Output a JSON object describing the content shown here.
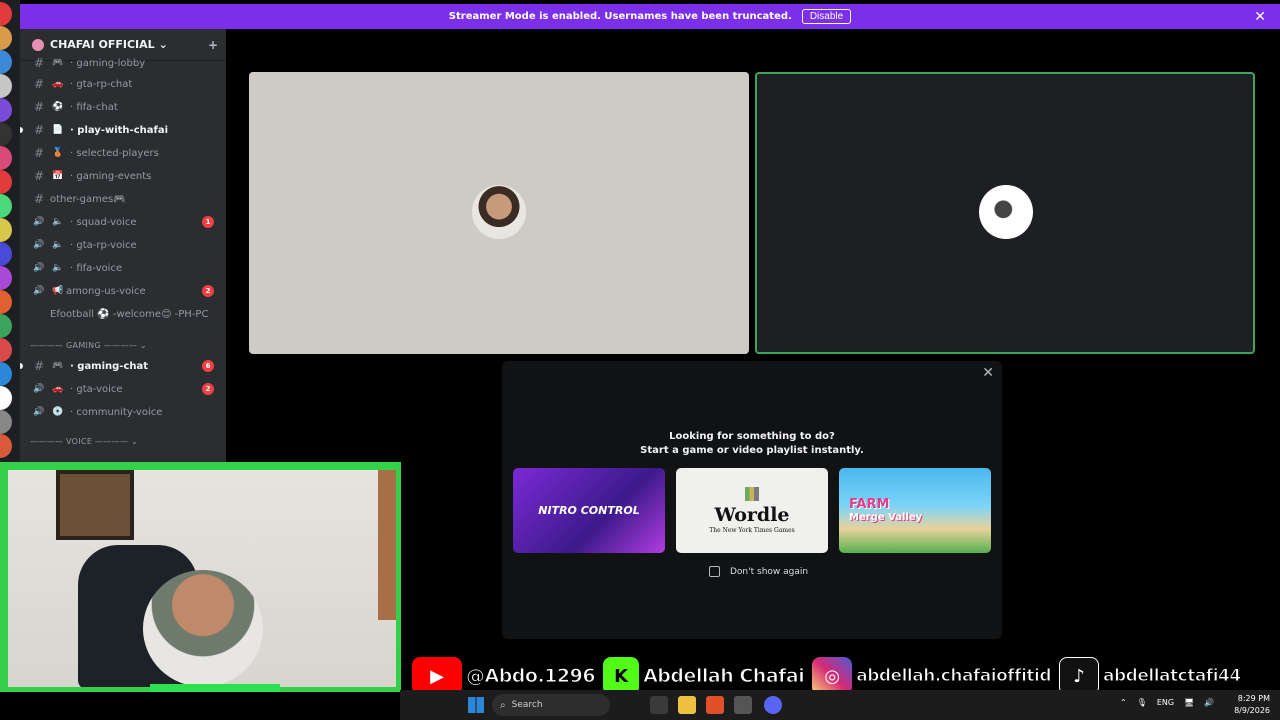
{
  "banner": {
    "message": "Streamer Mode is enabled. Usernames have been truncated.",
    "disable_label": "Disable",
    "close_glyph": "✕"
  },
  "guild": {
    "name": "CHAFAI OFFICIAL",
    "chevron": "⌄",
    "invite_icon": "person-add-icon"
  },
  "channels": [
    {
      "glyph": "#",
      "emoji": "🎮",
      "label": "· gaming-lobby",
      "badge": ""
    },
    {
      "glyph": "#",
      "emoji": "🚗",
      "label": "· gta-rp-chat",
      "badge": ""
    },
    {
      "glyph": "#",
      "emoji": "⚽",
      "label": "· fifa-chat",
      "badge": ""
    },
    {
      "glyph": "#",
      "emoji": "📄",
      "label": "· play-with-chafai",
      "badge": "",
      "active": true
    },
    {
      "glyph": "#",
      "emoji": "🥉",
      "label": "· selected-players",
      "badge": ""
    },
    {
      "glyph": "#",
      "emoji": "📅",
      "label": "· gaming-events",
      "badge": ""
    },
    {
      "glyph": "#",
      "emoji": "",
      "label": "other-games🎮",
      "badge": ""
    },
    {
      "glyph": "🔊",
      "emoji": "🔈",
      "label": "· squad-voice",
      "badge": "1"
    },
    {
      "glyph": "🔊",
      "emoji": "🔈",
      "label": "· gta-rp-voice",
      "badge": ""
    },
    {
      "glyph": "🔊",
      "emoji": "🔈",
      "label": "· fifa-voice",
      "badge": ""
    },
    {
      "glyph": "🔊",
      "emoji": "📢",
      "label": "among-us-voice",
      "badge": "2"
    },
    {
      "glyph": "",
      "emoji": "",
      "label": "Efootball ⚽ -welcome😊 -PH-PC",
      "badge": ""
    }
  ],
  "category_gaming": "———— GAMING ———— ⌄",
  "gaming_channels": [
    {
      "glyph": "#",
      "emoji": "🎮",
      "label": "· gaming-chat",
      "badge": "6",
      "active": true
    },
    {
      "glyph": "🔊",
      "emoji": "🚗",
      "label": "· gta-voice",
      "badge": "2"
    },
    {
      "glyph": "🔊",
      "emoji": "💿",
      "label": "· community-voice",
      "badge": ""
    }
  ],
  "category_voice": "———— VOICE ———— ⌄",
  "activity": {
    "close_glyph": "✕",
    "title": "Looking for something to do?",
    "subtitle": "Start a game or video playlist instantly.",
    "cards": [
      {
        "name": "NITRO CONTROL"
      },
      {
        "name": "Wordle",
        "sub": "The New York Times Games"
      },
      {
        "name": "FARM",
        "sub": "Merge Valley"
      }
    ],
    "dont_show_label": "Don't show again"
  },
  "socials": {
    "youtube": "@Abdo.1296",
    "kick": "Abdellah Chafai",
    "instagram": "abdellah.chafaioffitid",
    "tiktok": "abdellatctafi44"
  },
  "taskbar": {
    "search_placeholder": "Search",
    "lang": "ENG",
    "time": "8:29 PM",
    "date": "8/9/2026"
  },
  "colors": {
    "banner": "#7b2fe8",
    "sidebar": "#2b2d31",
    "speaking_outline": "#3ba55d",
    "mention_badge": "#f23f43",
    "webcam_frame": "#35d04a"
  }
}
